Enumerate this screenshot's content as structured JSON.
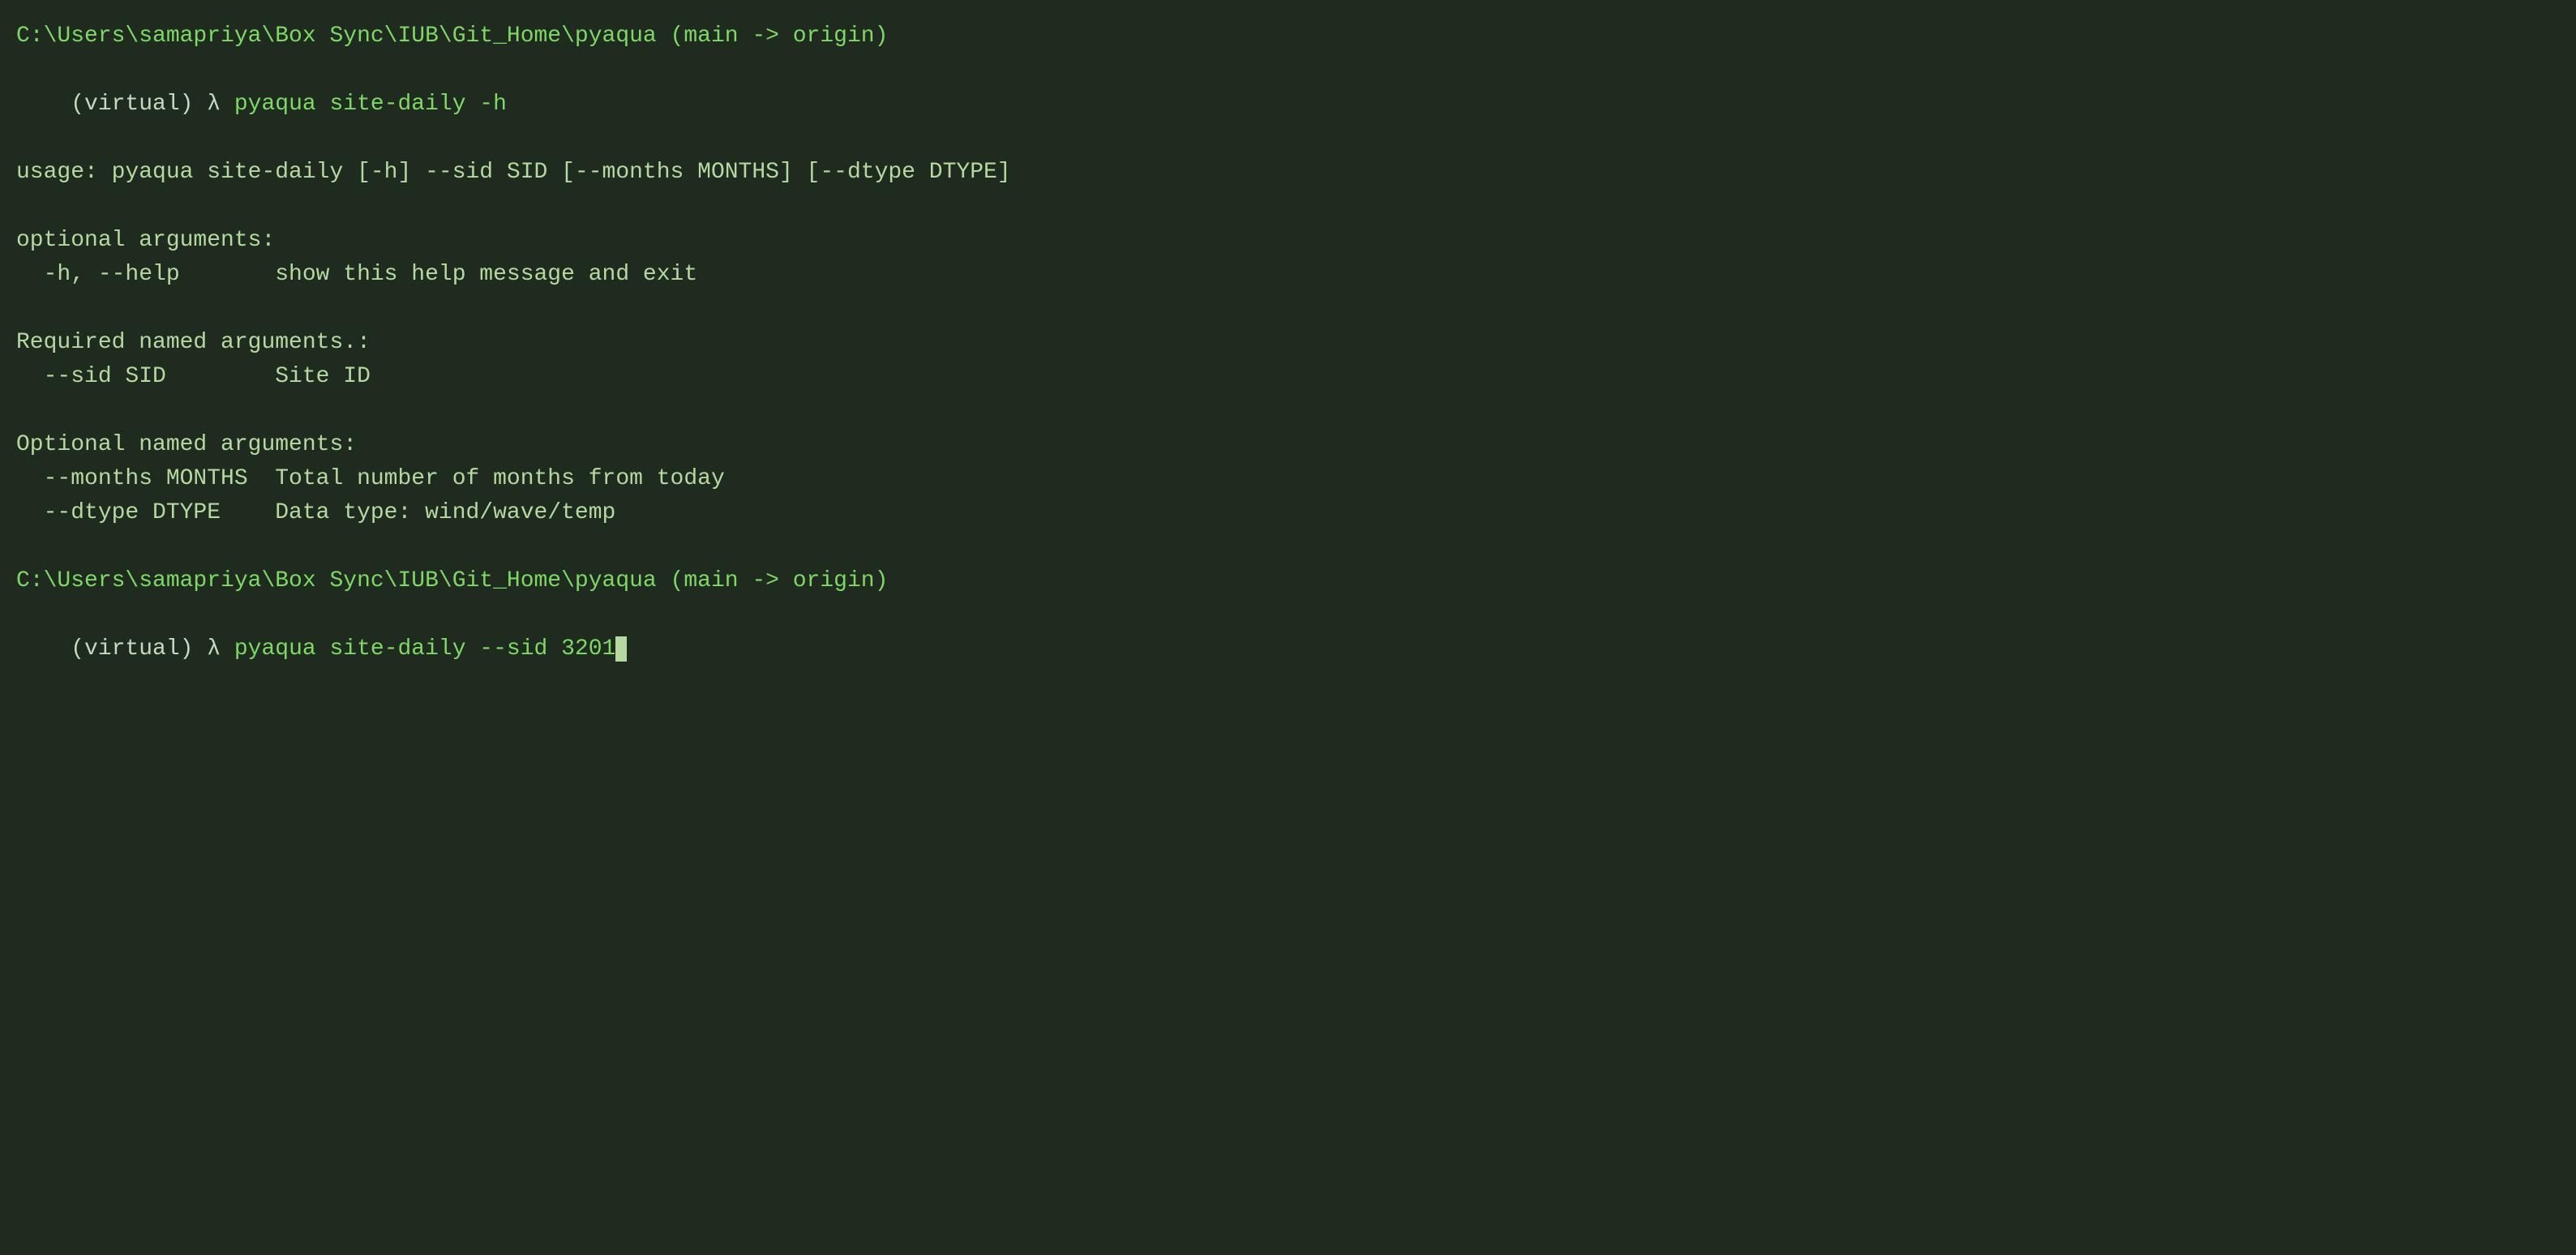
{
  "terminal": {
    "bg_color": "#1e2b1e",
    "text_color": "#b5d9a0",
    "bright_green": "#7fd866",
    "lines": [
      {
        "id": "path1",
        "type": "path",
        "text": "C:\\Users\\samapriya\\Box Sync\\IUB\\Git_Home\\pyaqua (main -> origin)"
      },
      {
        "id": "cmd1",
        "type": "command",
        "prompt": "(virtual) λ ",
        "command": "pyaqua site-daily -h"
      },
      {
        "id": "usage1",
        "type": "output",
        "text": "usage: pyaqua site-daily [-h] --sid SID [--months MONTHS] [--dtype DTYPE]"
      },
      {
        "id": "empty1",
        "type": "empty"
      },
      {
        "id": "optional_header",
        "type": "output",
        "text": "optional arguments:"
      },
      {
        "id": "help_arg",
        "type": "output",
        "text": "  -h, --help       show this help message and exit"
      },
      {
        "id": "empty2",
        "type": "empty"
      },
      {
        "id": "required_header",
        "type": "output",
        "text": "Required named arguments.:"
      },
      {
        "id": "sid_arg",
        "type": "output",
        "text": "  --sid SID        Site ID"
      },
      {
        "id": "empty3",
        "type": "empty"
      },
      {
        "id": "optional_named_header",
        "type": "output",
        "text": "Optional named arguments:"
      },
      {
        "id": "months_arg",
        "type": "output",
        "text": "  --months MONTHS  Total number of months from today"
      },
      {
        "id": "dtype_arg",
        "type": "output",
        "text": "  --dtype DTYPE    Data type: wind/wave/temp"
      },
      {
        "id": "empty4",
        "type": "empty"
      },
      {
        "id": "path2",
        "type": "path",
        "text": "C:\\Users\\samapriya\\Box Sync\\IUB\\Git_Home\\pyaqua (main -> origin)"
      },
      {
        "id": "cmd2",
        "type": "command",
        "prompt": "(virtual) λ ",
        "command": "pyaqua site-daily --sid 3201"
      }
    ]
  }
}
